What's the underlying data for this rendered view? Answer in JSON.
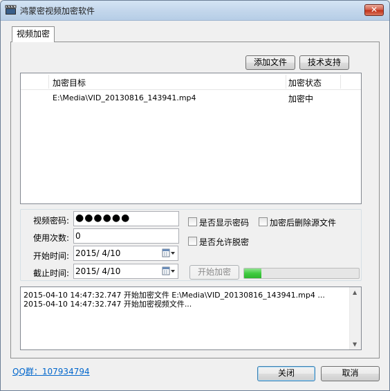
{
  "window": {
    "title": "鸿蒙密视频加密软件",
    "close_glyph": "✕"
  },
  "tabs": [
    {
      "label": "视频加密",
      "selected": true
    }
  ],
  "toolbar": {
    "add_file_label": "添加文件",
    "tech_support_label": "技术支持"
  },
  "file_list": {
    "columns": [
      "加密目标",
      "加密状态"
    ],
    "rows": [
      {
        "target": "E:\\Media\\VID_20130816_143941.mp4",
        "status": "加密中"
      }
    ]
  },
  "form": {
    "password_label": "视频密码:",
    "password_value": "●●●●●●",
    "use_count_label": "使用次数:",
    "use_count_value": "0",
    "start_time_label": "开始时间:",
    "start_time_value": "2015/  4/10",
    "end_time_label": "截止时间:",
    "end_time_value": "2015/  4/10",
    "show_password_label": "是否显示密码",
    "delete_source_label": "加密后删除源文件",
    "allow_decrypt_label": "是否允许脱密",
    "start_encrypt_label": "开始加密",
    "progress_percent": 15
  },
  "log": {
    "lines": [
      "2015-04-10 14:47:32.747 开始加密文件 E:\\Media\\VID_20130816_143941.mp4 ...",
      "2015-04-10 14:47:32.747 开始加密视频文件..."
    ]
  },
  "footer": {
    "qq_link": "QQ群：107934794",
    "close_label": "关闭",
    "cancel_label": "取消"
  },
  "colors": {
    "link": "#0066cc",
    "progress": "#3fcb3f"
  }
}
